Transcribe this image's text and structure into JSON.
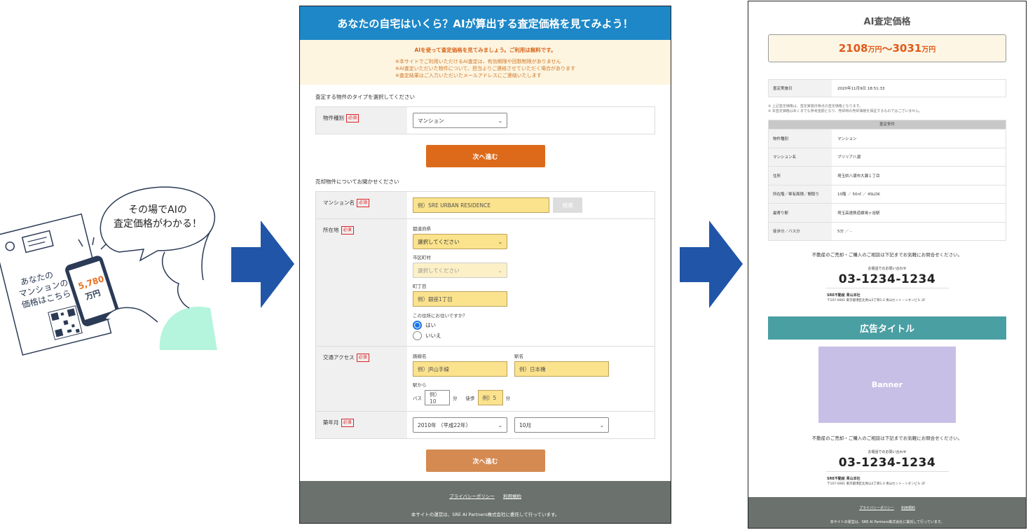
{
  "illustration": {
    "bubble_line1": "その場でAIの",
    "bubble_line2": "査定価格がわかる！",
    "flyer_line1": "あなたの",
    "flyer_line2": "マンションの",
    "flyer_line3": "価格はこちら",
    "phone_price": "5,780",
    "phone_unit": "万円"
  },
  "form": {
    "header": "あなたの自宅はいくら？AIが算出する査定価格を見てみよう！",
    "notice_main": "AIを使って査定価格を見てみましょう。ご利用は無料です。",
    "notice_1": "※本サイトでご利用いただけるAI査定は、有効期限や回数制限がありません",
    "notice_2": "※AI査定いただいた物件について、担当よりご連絡させていただく場合があります",
    "notice_3": "※査定結果はご入力いただいたメールアドレスにご連絡いたします",
    "section1_title": "査定する物件のタイプを選択してください",
    "required": "必須",
    "type_label": "物件種別",
    "type_value": "マンション",
    "next_label": "次へ進む",
    "section2_title": "売却物件についてお聞かせください",
    "mansion_label": "マンション名",
    "mansion_placeholder": "例）SRE URBAN RESIDENCE",
    "search_label": "検索",
    "location_label": "所在地",
    "pref_label": "都道府県",
    "pref_value": "選択してください",
    "city_label": "市区町村",
    "city_value": "選択してください",
    "town_label": "町丁目",
    "town_placeholder": "例）銀座1丁目",
    "live_question": "この住所にお住いですか？",
    "yes_label": "はい",
    "no_label": "いいえ",
    "access_label": "交通アクセス",
    "line_label": "路線名",
    "line_placeholder": "例）JR山手線",
    "station_label": "駅名",
    "station_placeholder": "例）日本橋",
    "from_station": "駅から",
    "bus_label": "バス",
    "bus_placeholder": "例）10",
    "minutes": "分",
    "walk_label": "徒歩",
    "walk_placeholder": "例）5",
    "built_label": "築年月",
    "year_value": "2010年 （平成22年）",
    "month_value": "10月",
    "footer_privacy": "プライバシーポリシー",
    "footer_terms": "利用規約",
    "footer_note": "本サイトの運営は、SRE AI Partners株式会社に委託して行っています。"
  },
  "result": {
    "title": "AI査定価格",
    "price_low": "2108",
    "price_unit": "万円",
    "price_sep": "〜",
    "price_high": "3031",
    "date_label": "査定実施日",
    "date_value": "2020年11月9日 18:51:33",
    "note_1": "※ 上記査定価格は、査定実施日時点の査定価格となります。",
    "note_2": "※ 本査定価格はあくまでも参考金額となり、売却時の売却価格を保証するものではございません。",
    "cond_head": "査定条件",
    "conditions": [
      {
        "k": "物件種別",
        "v": "マンション"
      },
      {
        "k": "マンション名",
        "v": "ブリリア八潮"
      },
      {
        "k": "住所",
        "v": "埼玉県八潮市大瀬１丁目"
      },
      {
        "k": "所在階／専有面積／間取り",
        "v": "10階 ／ 50㎡ ／ 4SLDK"
      },
      {
        "k": "最寄り駅",
        "v": "埼玉高速鉄道線鳩ヶ谷駅"
      },
      {
        "k": "徒歩分／バス分",
        "v": "5分 ／ -"
      }
    ],
    "contact_lead": "不動産のご売却・ご購入のご相談は下記までお気軽にお問合せください。",
    "tel_label": "お電話でのお問い合わせ",
    "tel": "03-1234-1234",
    "company": "SRE不動産 青山本社",
    "address": "〒107-0061 東京都港区北青山3丁目1-2 青山セント・シオンビル 2F",
    "ad_title": "広告タイトル",
    "banner": "Banner",
    "footer_privacy": "プライバシーポリシー",
    "footer_terms": "利用規約",
    "footer_note": "本サイトの運営は、SRE AI Partners株式会社に委託して行っています。"
  },
  "colors": {
    "arrow": "#2055a8",
    "header_blue": "#1d87c7",
    "button_orange": "#dd6a1a",
    "price_orange": "#e05a1a",
    "ad_teal": "#4a9fa3",
    "banner_purple": "#c7bfe6",
    "footer_gray": "#6b716c",
    "illust_mint": "#b5f5dd"
  }
}
